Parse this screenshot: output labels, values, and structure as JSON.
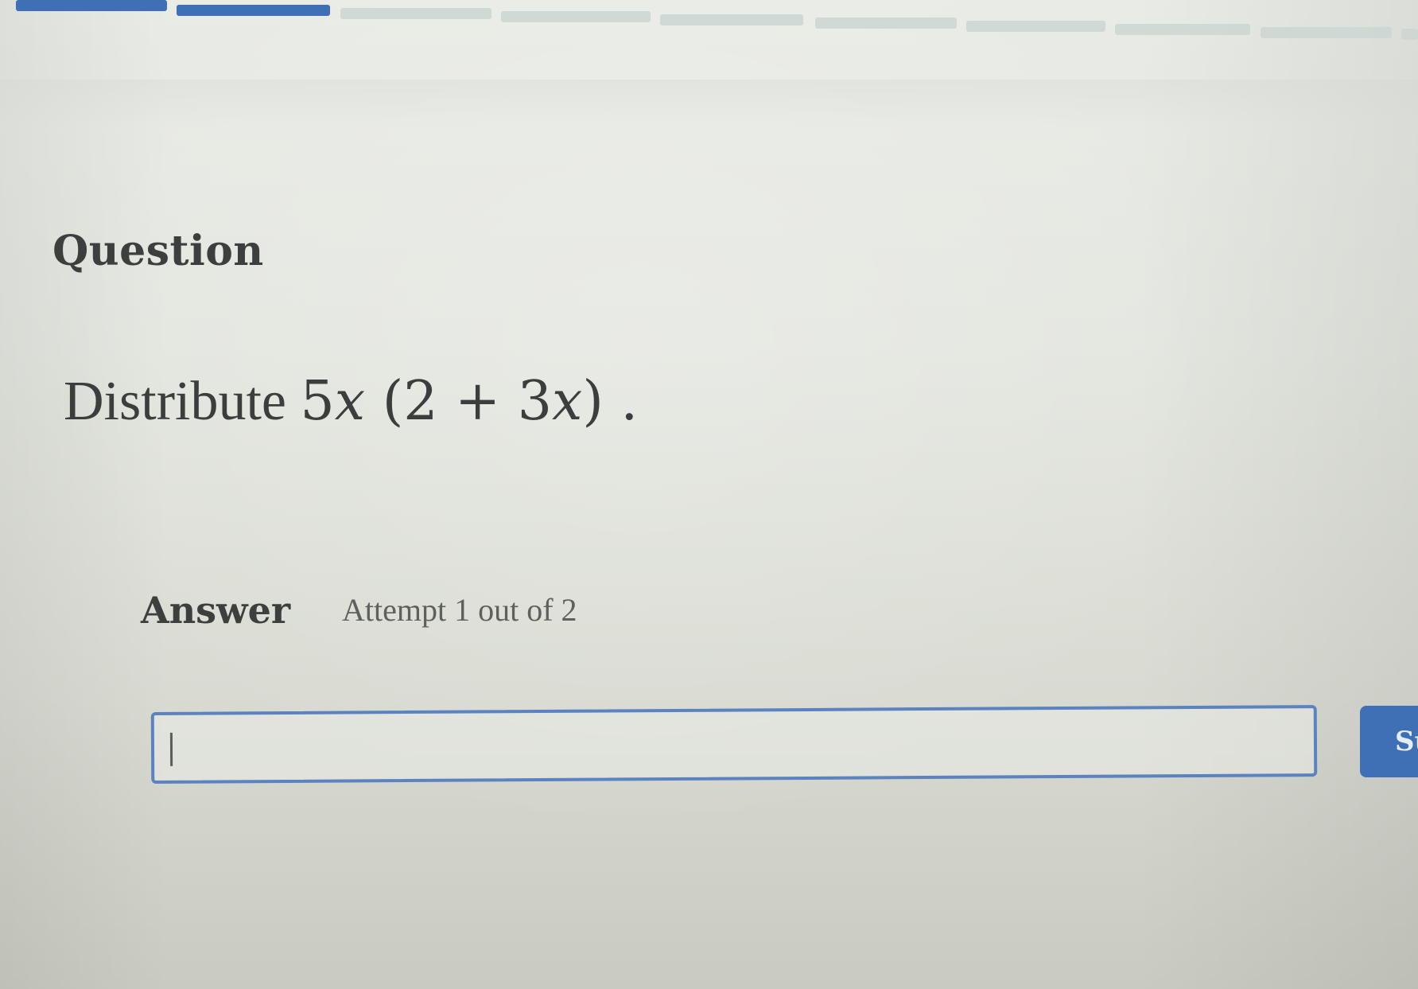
{
  "question": {
    "heading": "Question",
    "prompt_text": "Distribute",
    "expression": {
      "coefficient": "5",
      "variable": "x",
      "open_paren": "(",
      "term1": "2",
      "operator": " + ",
      "term2_coef": "3",
      "term2_var": "x",
      "close_paren": ")",
      "period": "."
    }
  },
  "answer": {
    "label": "Answer",
    "attempt_text": "Attempt 1 out of 2",
    "input_value": "",
    "submit_label": "Submit"
  },
  "progress": {
    "completed_segments": 2,
    "total_segments": 10
  },
  "colors": {
    "accent": "#3f6fb4",
    "input_border": "#5b83bf",
    "text": "#3c3f3d"
  }
}
